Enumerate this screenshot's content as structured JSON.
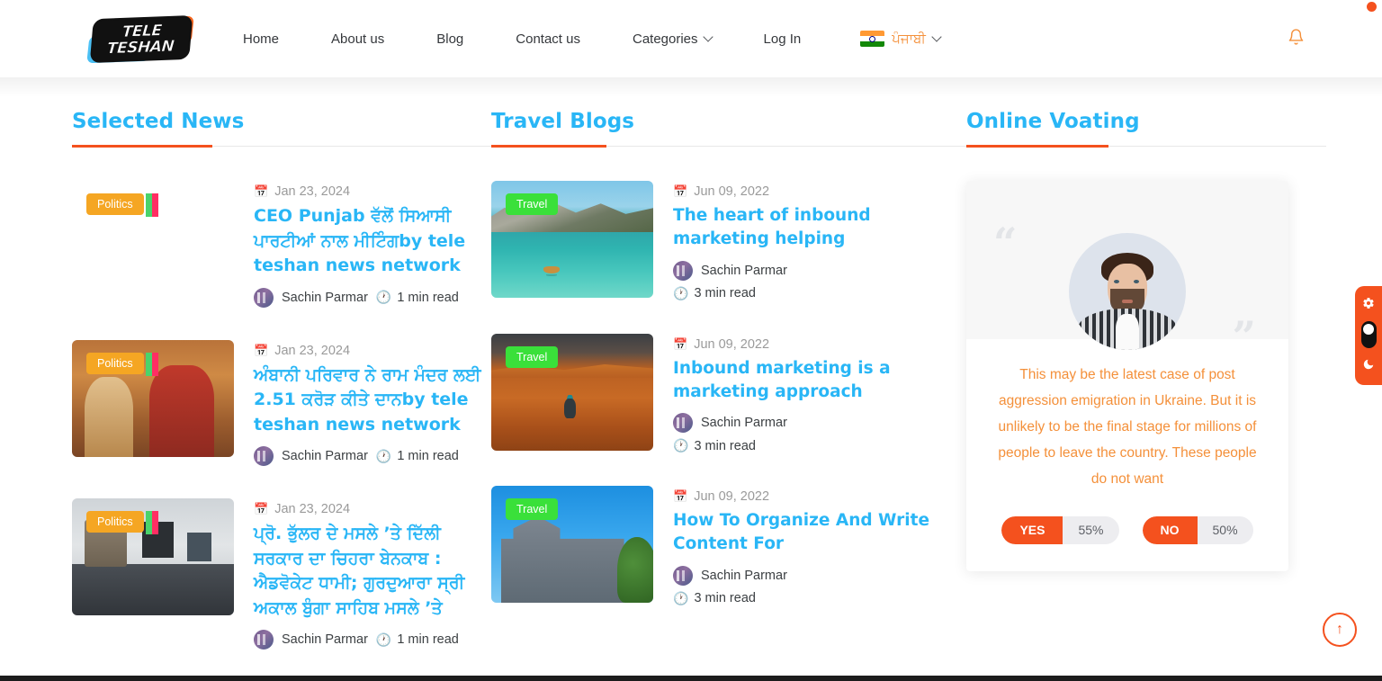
{
  "site": {
    "logo_line1": "TELE",
    "logo_line2": "TESHAN"
  },
  "header": {
    "nav": [
      {
        "label": "Home",
        "has_dropdown": false
      },
      {
        "label": "About us",
        "has_dropdown": false
      },
      {
        "label": "Blog",
        "has_dropdown": false
      },
      {
        "label": "Contact us",
        "has_dropdown": false
      },
      {
        "label": "Categories",
        "has_dropdown": true
      },
      {
        "label": "Log In",
        "has_dropdown": false
      }
    ],
    "language": {
      "label": "ਪੰਜਾਬੀ",
      "flag": "india-flag-icon",
      "has_dropdown": true
    },
    "bell_icon": "notification-bell-icon"
  },
  "sections": {
    "news": {
      "title": "Selected News"
    },
    "blogs": {
      "title": "Travel Blogs"
    },
    "vote": {
      "title": "Online Voating"
    }
  },
  "news_items": [
    {
      "badge": "Politics",
      "date": "Jan 23, 2024",
      "title": "CEO Punjab ਵੱਲੋਂ ਸਿਆਸੀ ਪਾਰਟੀਆਂ ਨਾਲ ਮੀਟਿੰਗby tele teshan news network",
      "author": "Sachin Parmar",
      "read": "1 min read",
      "image": "thumb-empty"
    },
    {
      "badge": "Politics",
      "date": "Jan 23, 2024",
      "title": "ਅੰਬਾਨੀ ਪਰਿਵਾਰ ਨੇ ਰਾਮ ਮੰਦਰ ਲਈ 2.51 ਕਰੋੜ ਕੀਤੇ ਦਾਨby tele teshan news network",
      "author": "Sachin Parmar",
      "read": "1 min read",
      "image": "thumb-temple-ceremony"
    },
    {
      "badge": "Politics",
      "date": "Jan 23, 2024",
      "title": "ਪ੍ਰੋ. ਭੁੱਲਰ ਦੇ ਮਸਲੇ ’ਤੇ ਦਿੱਲੀ ਸਰਕਾਰ ਦਾ ਚਿਹਰਾ ਬੇਨਕਾਬ : ਐਡਵੋਕੇਟ ਧਾਮੀ; ਗੁਰਦੁਆਰਾ ਸ੍ਰੀ ਅਕਾਲ ਬੁੰਗਾ ਸਾਹਿਬ ਮਸਲੇ ’ਤੇ",
      "author": "Sachin Parmar",
      "read": "1 min read",
      "image": "thumb-office-meeting"
    }
  ],
  "blog_items": [
    {
      "badge": "Travel",
      "date": "Jun 09, 2022",
      "title": "The heart of inbound marketing helping",
      "author": "Sachin Parmar",
      "read": "3 min read",
      "image": "thumb-lake-mountains"
    },
    {
      "badge": "Travel",
      "date": "Jun 09, 2022",
      "title": "Inbound marketing is a marketing approach",
      "author": "Sachin Parmar",
      "read": "3 min read",
      "image": "thumb-desert-person"
    },
    {
      "badge": "Travel",
      "date": "Jun 09, 2022",
      "title": "How To Organize And Write Content For",
      "author": "Sachin Parmar",
      "read": "3 min read",
      "image": "thumb-stone-church"
    }
  ],
  "vote_card": {
    "quote_open": "“",
    "quote_close": "”",
    "quote": "This may be the latest case of post aggression emigration in Ukraine. But it is unlikely to be the final stage for millions of people to leave the country. These people do not want",
    "yes_label": "YES",
    "yes_percent": "55%",
    "no_label": "NO",
    "no_percent": "50%"
  },
  "widgets": {
    "settings_icon": "gear-icon",
    "dark_mode_icon": "moon-icon",
    "theme_toggle": "theme-toggle-switch",
    "scroll_top_icon": "↑"
  },
  "icons": {
    "calendar": "📅",
    "clock": "🕐",
    "bell": "🔔"
  },
  "colors": {
    "accent_orange": "#f4511e",
    "title_blue": "#29b6f6",
    "badge_politics": "#f5a623",
    "badge_travel": "#3ae03a",
    "quote_orange": "#f4903a"
  }
}
